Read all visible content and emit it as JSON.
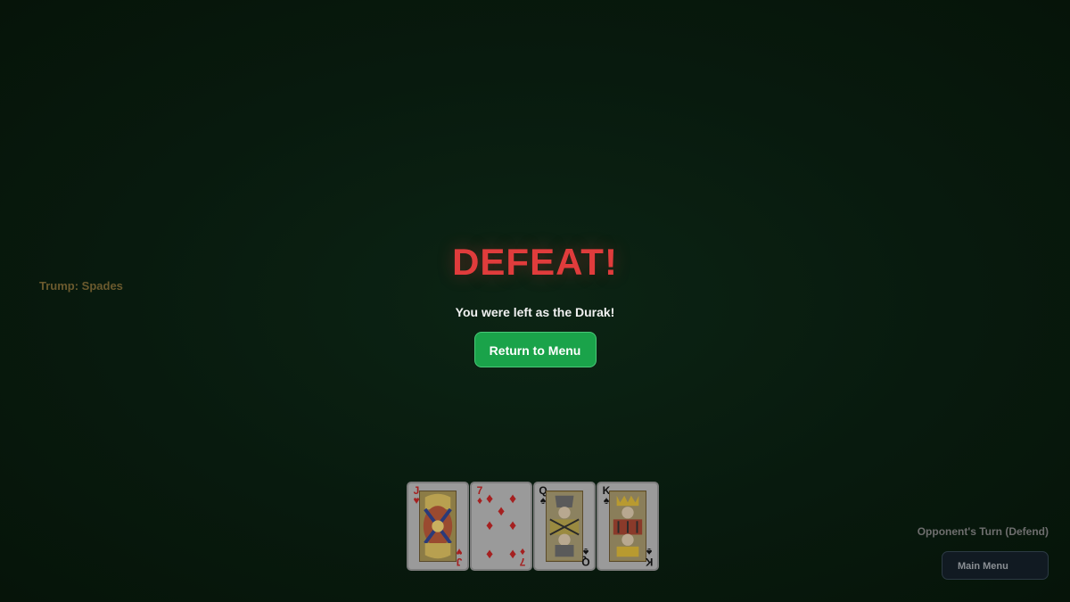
{
  "trump": {
    "label": "Trump: Spades"
  },
  "result": {
    "title": "DEFEAT!",
    "subtitle": "You were left as the Durak!",
    "return_label": "Return to Menu"
  },
  "status": {
    "turn_text": "Opponent's Turn (Defend)"
  },
  "menu": {
    "label": "Main Menu"
  },
  "colors": {
    "defeat": "#e03c3c",
    "return_button": "#1aa34a",
    "trump_text": "#6b5a2e"
  },
  "hand": [
    {
      "rank": "J",
      "suit": "♥",
      "suit_name": "hearts"
    },
    {
      "rank": "7",
      "suit": "♦",
      "suit_name": "diamonds"
    },
    {
      "rank": "Q",
      "suit": "♠",
      "suit_name": "spades"
    },
    {
      "rank": "K",
      "suit": "♠",
      "suit_name": "spades"
    }
  ]
}
